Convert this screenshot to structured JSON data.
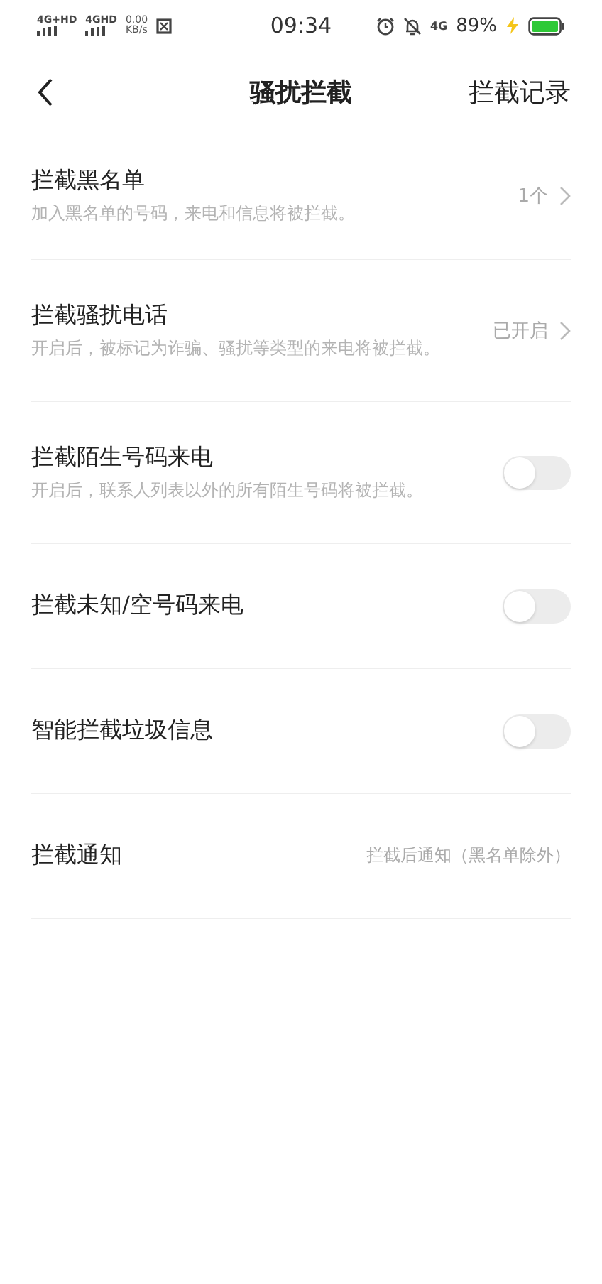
{
  "status_bar": {
    "sim_1": "4G+HD",
    "sim_2": "4GHD",
    "speed": "0.00",
    "speed_unit": "KB/s",
    "time": "09:34",
    "network": "4G",
    "battery": "89%",
    "charging": true
  },
  "header": {
    "title": "骚扰拦截",
    "action": "拦截记录"
  },
  "settings": [
    {
      "kind": "link",
      "title": "拦截黑名单",
      "description": "加入黑名单的号码，来电和信息将被拦截。",
      "value": "1个"
    },
    {
      "kind": "link",
      "title": "拦截骚扰电话",
      "description": "开启后，被标记为诈骗、骚扰等类型的来电将被拦截。",
      "value": "已开启"
    },
    {
      "kind": "toggle",
      "title": "拦截陌生号码来电",
      "description": "开启后，联系人列表以外的所有陌生号码将被拦截。",
      "on": false
    },
    {
      "kind": "toggle",
      "title": "拦截未知/空号码来电",
      "on": false
    },
    {
      "kind": "toggle",
      "title": "智能拦截垃圾信息",
      "on": false
    },
    {
      "kind": "value",
      "title": "拦截通知",
      "value": "拦截后通知（黑名单除外）"
    }
  ]
}
